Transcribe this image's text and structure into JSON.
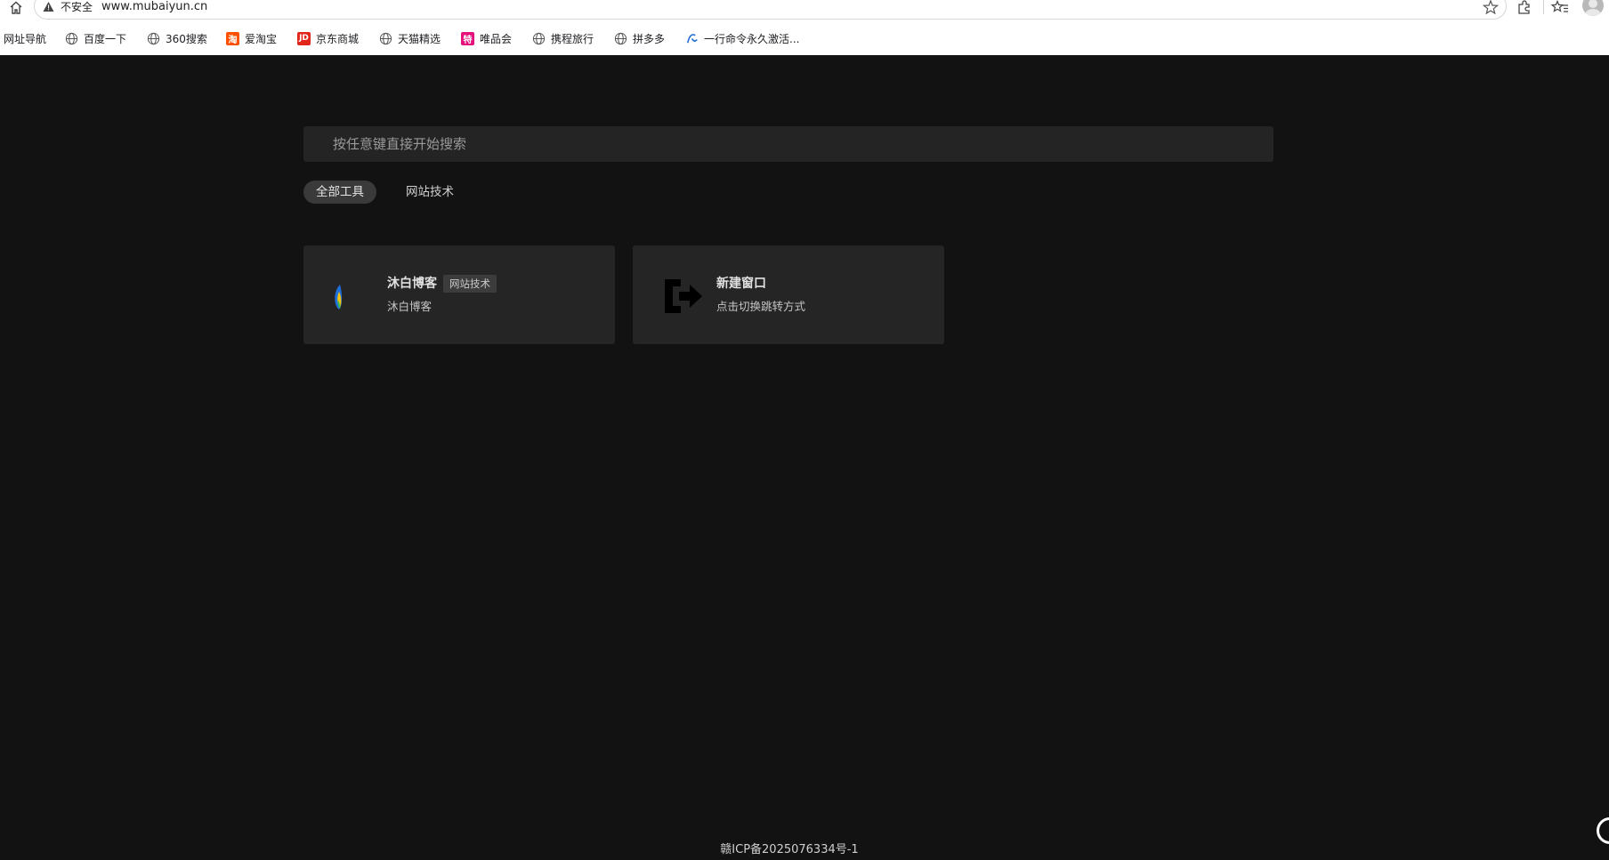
{
  "browser": {
    "security_label": "不安全",
    "url": "www.mubaiyun.cn",
    "bookmarks": [
      {
        "label": "网址导航",
        "icon": "none"
      },
      {
        "label": "百度一下",
        "icon": "globe-icon"
      },
      {
        "label": "360搜索",
        "icon": "globe-icon"
      },
      {
        "label": "爱淘宝",
        "icon": "taobao-icon",
        "glyph": "淘",
        "color": "#ff5000"
      },
      {
        "label": "京东商城",
        "icon": "jd-icon",
        "glyph": "JD",
        "color": "#e1251b"
      },
      {
        "label": "天猫精选",
        "icon": "globe-icon"
      },
      {
        "label": "唯品会",
        "icon": "vip-icon",
        "glyph": "特",
        "color": "#e5127d"
      },
      {
        "label": "携程旅行",
        "icon": "globe-icon"
      },
      {
        "label": "拼多多",
        "icon": "globe-icon"
      },
      {
        "label": "一行命令永久激活...",
        "icon": "custom-site-icon"
      }
    ]
  },
  "search": {
    "placeholder": "按任意键直接开始搜索"
  },
  "tabs": [
    {
      "label": "全部工具",
      "active": true
    },
    {
      "label": "网站技术",
      "active": false
    }
  ],
  "cards": [
    {
      "title": "沐白博客",
      "tag": "网站技术",
      "description": "沐白博客",
      "icon": "mubai-logo-icon"
    },
    {
      "title": "新建窗口",
      "tag": "",
      "description": "点击切换跳转方式",
      "icon": "new-window-icon"
    }
  ],
  "footer": {
    "icp": "赣ICP备2025076334号-1"
  },
  "colors": {
    "page_bg": "#121212",
    "surface": "#252525",
    "chip_active": "#3a3a3a"
  }
}
